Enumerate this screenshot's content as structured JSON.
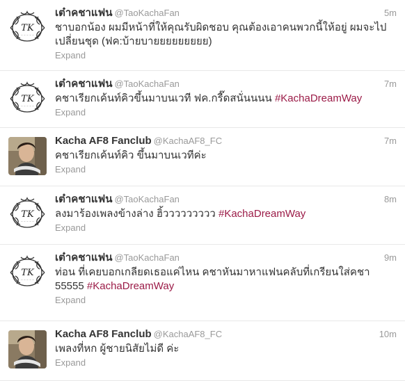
{
  "colors": {
    "text": "#333333",
    "meta": "#999999",
    "hashtag": "#9b1b47",
    "divider": "#e8e8e8"
  },
  "tweets": [
    {
      "fullname": "เต๋าคชาแฟน",
      "username": "@TaoKachaFan",
      "time": "5m",
      "text_before": "ชาบอกน้อง ผมมีหน้าที่ให้คุณรับผิดชอบ คุณต้องเอาคนพวกนี้ให้อยู่ ผมจะไปเปลี่ยนชุด (ฟค:บ้ายบายยยยยยยยย)",
      "hashtag": "",
      "expand": "Expand",
      "avatar": "tk-logo-avatar"
    },
    {
      "fullname": "เต๋าคชาแฟน",
      "username": "@TaoKachaFan",
      "time": "7m",
      "text_before": "คชาเรียกเค้นท์คิวขึ้นมาบนเวที ฟค.กรี๊ดสนั่นนนน ",
      "hashtag": "#KachaDreamWay",
      "expand": "Expand",
      "avatar": "tk-logo-avatar"
    },
    {
      "fullname": "Kacha AF8 Fanclub",
      "username": "@KachaAF8_FC",
      "time": "7m",
      "text_before": "คชาเรียกเค้นท์คิว ขึ้นมาบนเวทีค่ะ",
      "hashtag": "",
      "expand": "Expand",
      "avatar": "photo-avatar"
    },
    {
      "fullname": "เต๋าคชาแฟน",
      "username": "@TaoKachaFan",
      "time": "8m",
      "text_before": "ลงมาร้องเพลงข้างล่าง ฮิ้ววววววววว ",
      "hashtag": "#KachaDreamWay",
      "expand": "Expand",
      "avatar": "tk-logo-avatar"
    },
    {
      "fullname": "เต๋าคชาแฟน",
      "username": "@TaoKachaFan",
      "time": "9m",
      "text_before": "ท่อน ที่เคยบอกเกลียดเธอแค่ไหน คชาหันมาหาแฟนคลับที่เกรียนใส่คชา 55555 ",
      "hashtag": "#KachaDreamWay",
      "expand": "Expand",
      "avatar": "tk-logo-avatar"
    },
    {
      "fullname": "Kacha AF8 Fanclub",
      "username": "@KachaAF8_FC",
      "time": "10m",
      "text_before": "เพลงที่หก ผู้ชายนิสัยไม่ดี ค่ะ",
      "hashtag": "",
      "expand": "Expand",
      "avatar": "photo-avatar"
    }
  ]
}
